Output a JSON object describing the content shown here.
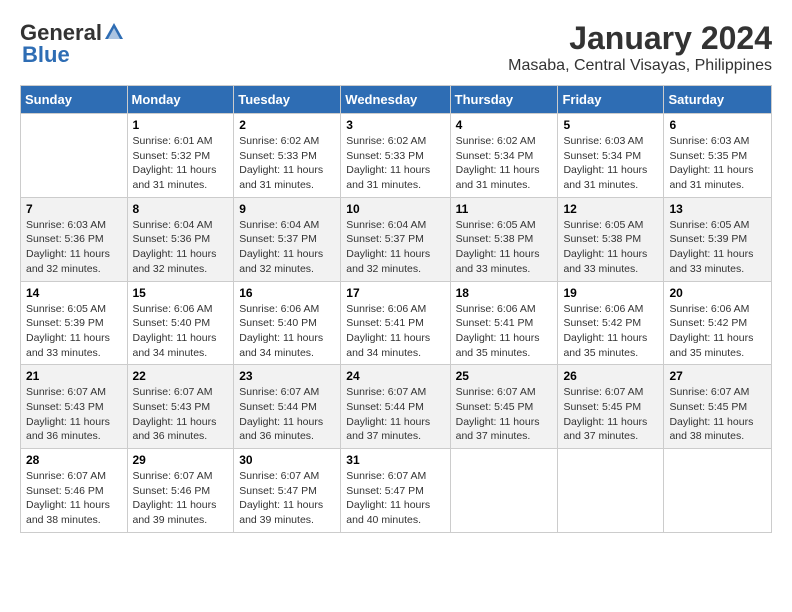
{
  "header": {
    "logo_line1": "General",
    "logo_line2": "Blue",
    "title": "January 2024",
    "subtitle": "Masaba, Central Visayas, Philippines"
  },
  "columns": [
    "Sunday",
    "Monday",
    "Tuesday",
    "Wednesday",
    "Thursday",
    "Friday",
    "Saturday"
  ],
  "weeks": [
    {
      "days": [
        {
          "num": "",
          "info": ""
        },
        {
          "num": "1",
          "info": "Sunrise: 6:01 AM\nSunset: 5:32 PM\nDaylight: 11 hours\nand 31 minutes."
        },
        {
          "num": "2",
          "info": "Sunrise: 6:02 AM\nSunset: 5:33 PM\nDaylight: 11 hours\nand 31 minutes."
        },
        {
          "num": "3",
          "info": "Sunrise: 6:02 AM\nSunset: 5:33 PM\nDaylight: 11 hours\nand 31 minutes."
        },
        {
          "num": "4",
          "info": "Sunrise: 6:02 AM\nSunset: 5:34 PM\nDaylight: 11 hours\nand 31 minutes."
        },
        {
          "num": "5",
          "info": "Sunrise: 6:03 AM\nSunset: 5:34 PM\nDaylight: 11 hours\nand 31 minutes."
        },
        {
          "num": "6",
          "info": "Sunrise: 6:03 AM\nSunset: 5:35 PM\nDaylight: 11 hours\nand 31 minutes."
        }
      ]
    },
    {
      "days": [
        {
          "num": "7",
          "info": "Sunrise: 6:03 AM\nSunset: 5:36 PM\nDaylight: 11 hours\nand 32 minutes."
        },
        {
          "num": "8",
          "info": "Sunrise: 6:04 AM\nSunset: 5:36 PM\nDaylight: 11 hours\nand 32 minutes."
        },
        {
          "num": "9",
          "info": "Sunrise: 6:04 AM\nSunset: 5:37 PM\nDaylight: 11 hours\nand 32 minutes."
        },
        {
          "num": "10",
          "info": "Sunrise: 6:04 AM\nSunset: 5:37 PM\nDaylight: 11 hours\nand 32 minutes."
        },
        {
          "num": "11",
          "info": "Sunrise: 6:05 AM\nSunset: 5:38 PM\nDaylight: 11 hours\nand 33 minutes."
        },
        {
          "num": "12",
          "info": "Sunrise: 6:05 AM\nSunset: 5:38 PM\nDaylight: 11 hours\nand 33 minutes."
        },
        {
          "num": "13",
          "info": "Sunrise: 6:05 AM\nSunset: 5:39 PM\nDaylight: 11 hours\nand 33 minutes."
        }
      ]
    },
    {
      "days": [
        {
          "num": "14",
          "info": "Sunrise: 6:05 AM\nSunset: 5:39 PM\nDaylight: 11 hours\nand 33 minutes."
        },
        {
          "num": "15",
          "info": "Sunrise: 6:06 AM\nSunset: 5:40 PM\nDaylight: 11 hours\nand 34 minutes."
        },
        {
          "num": "16",
          "info": "Sunrise: 6:06 AM\nSunset: 5:40 PM\nDaylight: 11 hours\nand 34 minutes."
        },
        {
          "num": "17",
          "info": "Sunrise: 6:06 AM\nSunset: 5:41 PM\nDaylight: 11 hours\nand 34 minutes."
        },
        {
          "num": "18",
          "info": "Sunrise: 6:06 AM\nSunset: 5:41 PM\nDaylight: 11 hours\nand 35 minutes."
        },
        {
          "num": "19",
          "info": "Sunrise: 6:06 AM\nSunset: 5:42 PM\nDaylight: 11 hours\nand 35 minutes."
        },
        {
          "num": "20",
          "info": "Sunrise: 6:06 AM\nSunset: 5:42 PM\nDaylight: 11 hours\nand 35 minutes."
        }
      ]
    },
    {
      "days": [
        {
          "num": "21",
          "info": "Sunrise: 6:07 AM\nSunset: 5:43 PM\nDaylight: 11 hours\nand 36 minutes."
        },
        {
          "num": "22",
          "info": "Sunrise: 6:07 AM\nSunset: 5:43 PM\nDaylight: 11 hours\nand 36 minutes."
        },
        {
          "num": "23",
          "info": "Sunrise: 6:07 AM\nSunset: 5:44 PM\nDaylight: 11 hours\nand 36 minutes."
        },
        {
          "num": "24",
          "info": "Sunrise: 6:07 AM\nSunset: 5:44 PM\nDaylight: 11 hours\nand 37 minutes."
        },
        {
          "num": "25",
          "info": "Sunrise: 6:07 AM\nSunset: 5:45 PM\nDaylight: 11 hours\nand 37 minutes."
        },
        {
          "num": "26",
          "info": "Sunrise: 6:07 AM\nSunset: 5:45 PM\nDaylight: 11 hours\nand 37 minutes."
        },
        {
          "num": "27",
          "info": "Sunrise: 6:07 AM\nSunset: 5:45 PM\nDaylight: 11 hours\nand 38 minutes."
        }
      ]
    },
    {
      "days": [
        {
          "num": "28",
          "info": "Sunrise: 6:07 AM\nSunset: 5:46 PM\nDaylight: 11 hours\nand 38 minutes."
        },
        {
          "num": "29",
          "info": "Sunrise: 6:07 AM\nSunset: 5:46 PM\nDaylight: 11 hours\nand 39 minutes."
        },
        {
          "num": "30",
          "info": "Sunrise: 6:07 AM\nSunset: 5:47 PM\nDaylight: 11 hours\nand 39 minutes."
        },
        {
          "num": "31",
          "info": "Sunrise: 6:07 AM\nSunset: 5:47 PM\nDaylight: 11 hours\nand 40 minutes."
        },
        {
          "num": "",
          "info": ""
        },
        {
          "num": "",
          "info": ""
        },
        {
          "num": "",
          "info": ""
        }
      ]
    }
  ]
}
